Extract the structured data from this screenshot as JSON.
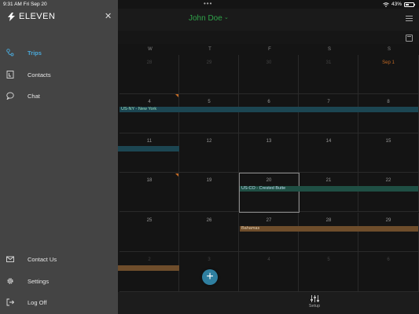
{
  "status_bar": {
    "time": "9:31 AM",
    "date": "Fri Sep 20",
    "dots": "•••",
    "battery": "43%"
  },
  "header": {
    "user_name": "John Doe",
    "chevron": "⌄",
    "user_color": "#2fa34a"
  },
  "drawer": {
    "logo_text": "ELEVEN",
    "close": "✕",
    "top_items": [
      {
        "label": "Trips",
        "icon": "trips-icon",
        "active": true
      },
      {
        "label": "Contacts",
        "icon": "contacts-icon",
        "active": false
      },
      {
        "label": "Chat",
        "icon": "chat-icon",
        "active": false
      }
    ],
    "bottom_items": [
      {
        "label": "Contact Us",
        "icon": "mail-icon"
      },
      {
        "label": "Settings",
        "icon": "gear-icon"
      },
      {
        "label": "Log Off",
        "icon": "logout-icon"
      }
    ],
    "active_color": "#4aa8d8"
  },
  "calendar": {
    "weekdays": [
      "W",
      "T",
      "F",
      "S",
      "S"
    ],
    "weeks": [
      [
        "28",
        "29",
        "30",
        "31",
        "Sep 1"
      ],
      [
        "4",
        "5",
        "6",
        "7",
        "8"
      ],
      [
        "11",
        "12",
        "13",
        "14",
        "15"
      ],
      [
        "18",
        "19",
        "20",
        "21",
        "22"
      ],
      [
        "25",
        "26",
        "27",
        "28",
        "29"
      ],
      [
        "2",
        "3",
        "4",
        "5",
        "6"
      ]
    ],
    "events": {
      "new_york": "US-NY - New York",
      "crested_butte": "US-CO - Crested Butte",
      "bahamas": "Bahamas"
    }
  },
  "fab": "+",
  "bottom_bar": {
    "setup_label": "Setup"
  }
}
